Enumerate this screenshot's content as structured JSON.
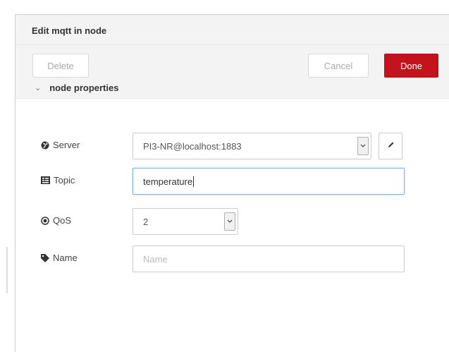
{
  "tray": {
    "title": "Edit mqtt in node"
  },
  "toolbar": {
    "delete_label": "Delete",
    "cancel_label": "Cancel",
    "done_label": "Done"
  },
  "section": {
    "title": "node properties"
  },
  "form": {
    "server": {
      "label": "Server",
      "value": "PI3-NR@localhost:1883",
      "icon": "globe-icon"
    },
    "topic": {
      "label": "Topic",
      "value": "temperature",
      "icon": "tasks-icon"
    },
    "qos": {
      "label": "QoS",
      "value": "2",
      "icon": "dot-circle-icon"
    },
    "name": {
      "label": "Name",
      "value": "",
      "placeholder": "Name",
      "icon": "tag-icon"
    }
  },
  "colors": {
    "done_bg": "#c3141e",
    "focus_border": "#85b7d9",
    "header_bg": "#f3f3f3"
  }
}
